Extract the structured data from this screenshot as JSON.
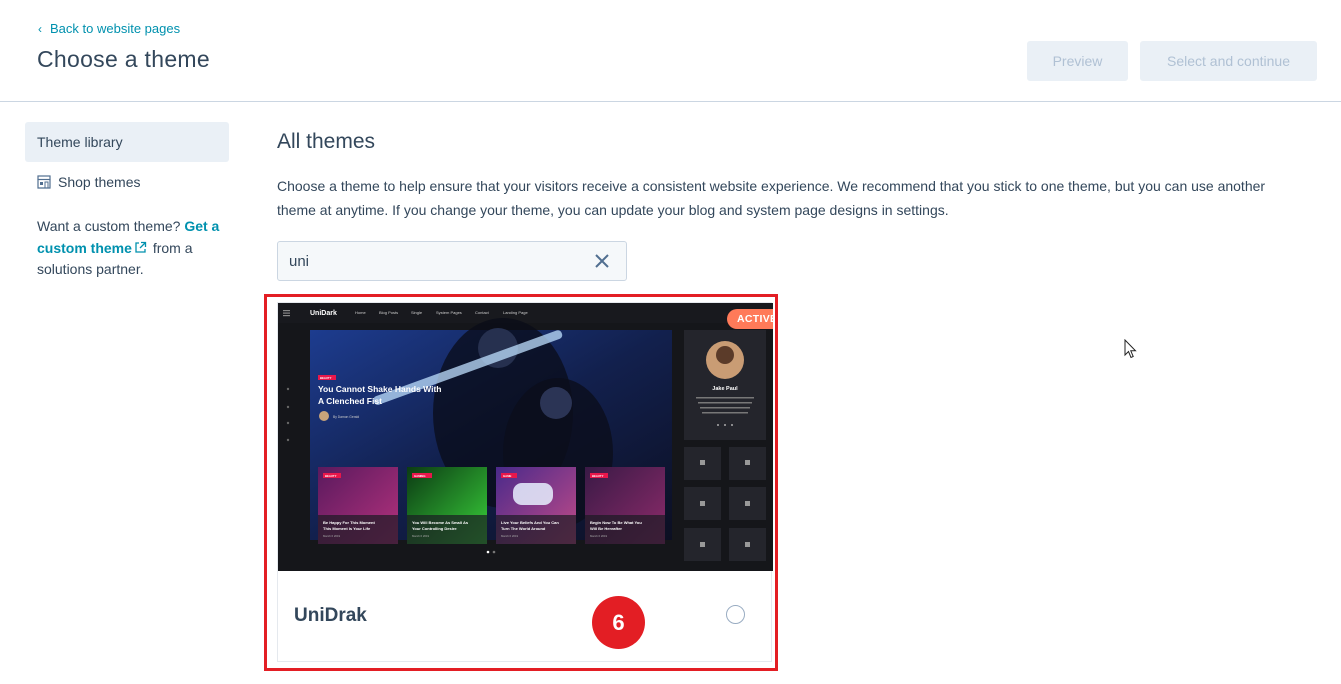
{
  "header": {
    "back_label": "Back to website pages",
    "title": "Choose a theme",
    "preview_label": "Preview",
    "select_label": "Select and continue"
  },
  "sidebar": {
    "items": [
      {
        "label": "Theme library",
        "active": true
      },
      {
        "label": "Shop themes",
        "icon": "store-icon"
      }
    ],
    "custom_prefix": "Want a custom theme?",
    "custom_link": "Get a custom theme",
    "custom_suffix": "from a solutions partner."
  },
  "main": {
    "title": "All themes",
    "description": "Choose a theme to help ensure that your visitors receive a consistent website experience. We recommend that you stick to one theme, but you can use another theme at anytime. If you change your theme, you can update your blog and system page designs in settings.",
    "search": {
      "value": "uni"
    },
    "themes": [
      {
        "name": "UniDrak",
        "badge": "ACTIVE",
        "preview": {
          "logo": "UniDark",
          "nav": [
            "Home",
            "Blog Posts",
            "Single",
            "System Pages",
            "Contact",
            "Landing Page"
          ],
          "hero_tag": "BEAUTY",
          "hero_title": "You Cannot Shake Hands With A Clenched Fist",
          "hero_author": "By Damon Gerald",
          "profile_name": "Jake Paul",
          "profile_bio": "A 25 year old health centric receptionist who enjoys going to the movies, photography and fashion music.",
          "posts": [
            {
              "tag": "BEAUTY",
              "title": "Be Happy For This Moment This Moment Is Your Life",
              "date": "March 6 2019"
            },
            {
              "tag": "GAMING",
              "title": "You Will Become As Small As Your Controlling Desire",
              "date": "March 6 2019"
            },
            {
              "tag": "GAME",
              "title": "Live Your Beliefs And You Can Turn The World Around",
              "date": "March 6 2019"
            },
            {
              "tag": "BEAUTY",
              "title": "Begin Now To Be What You Will Be Hereafter",
              "date": "March 6 2019"
            }
          ]
        }
      }
    ]
  },
  "annotation": {
    "step": "6"
  },
  "colors": {
    "accent": "#0091ae",
    "active_badge": "#ff7a59",
    "highlight": "#e31e24",
    "preview_pink": "#e8174b"
  }
}
